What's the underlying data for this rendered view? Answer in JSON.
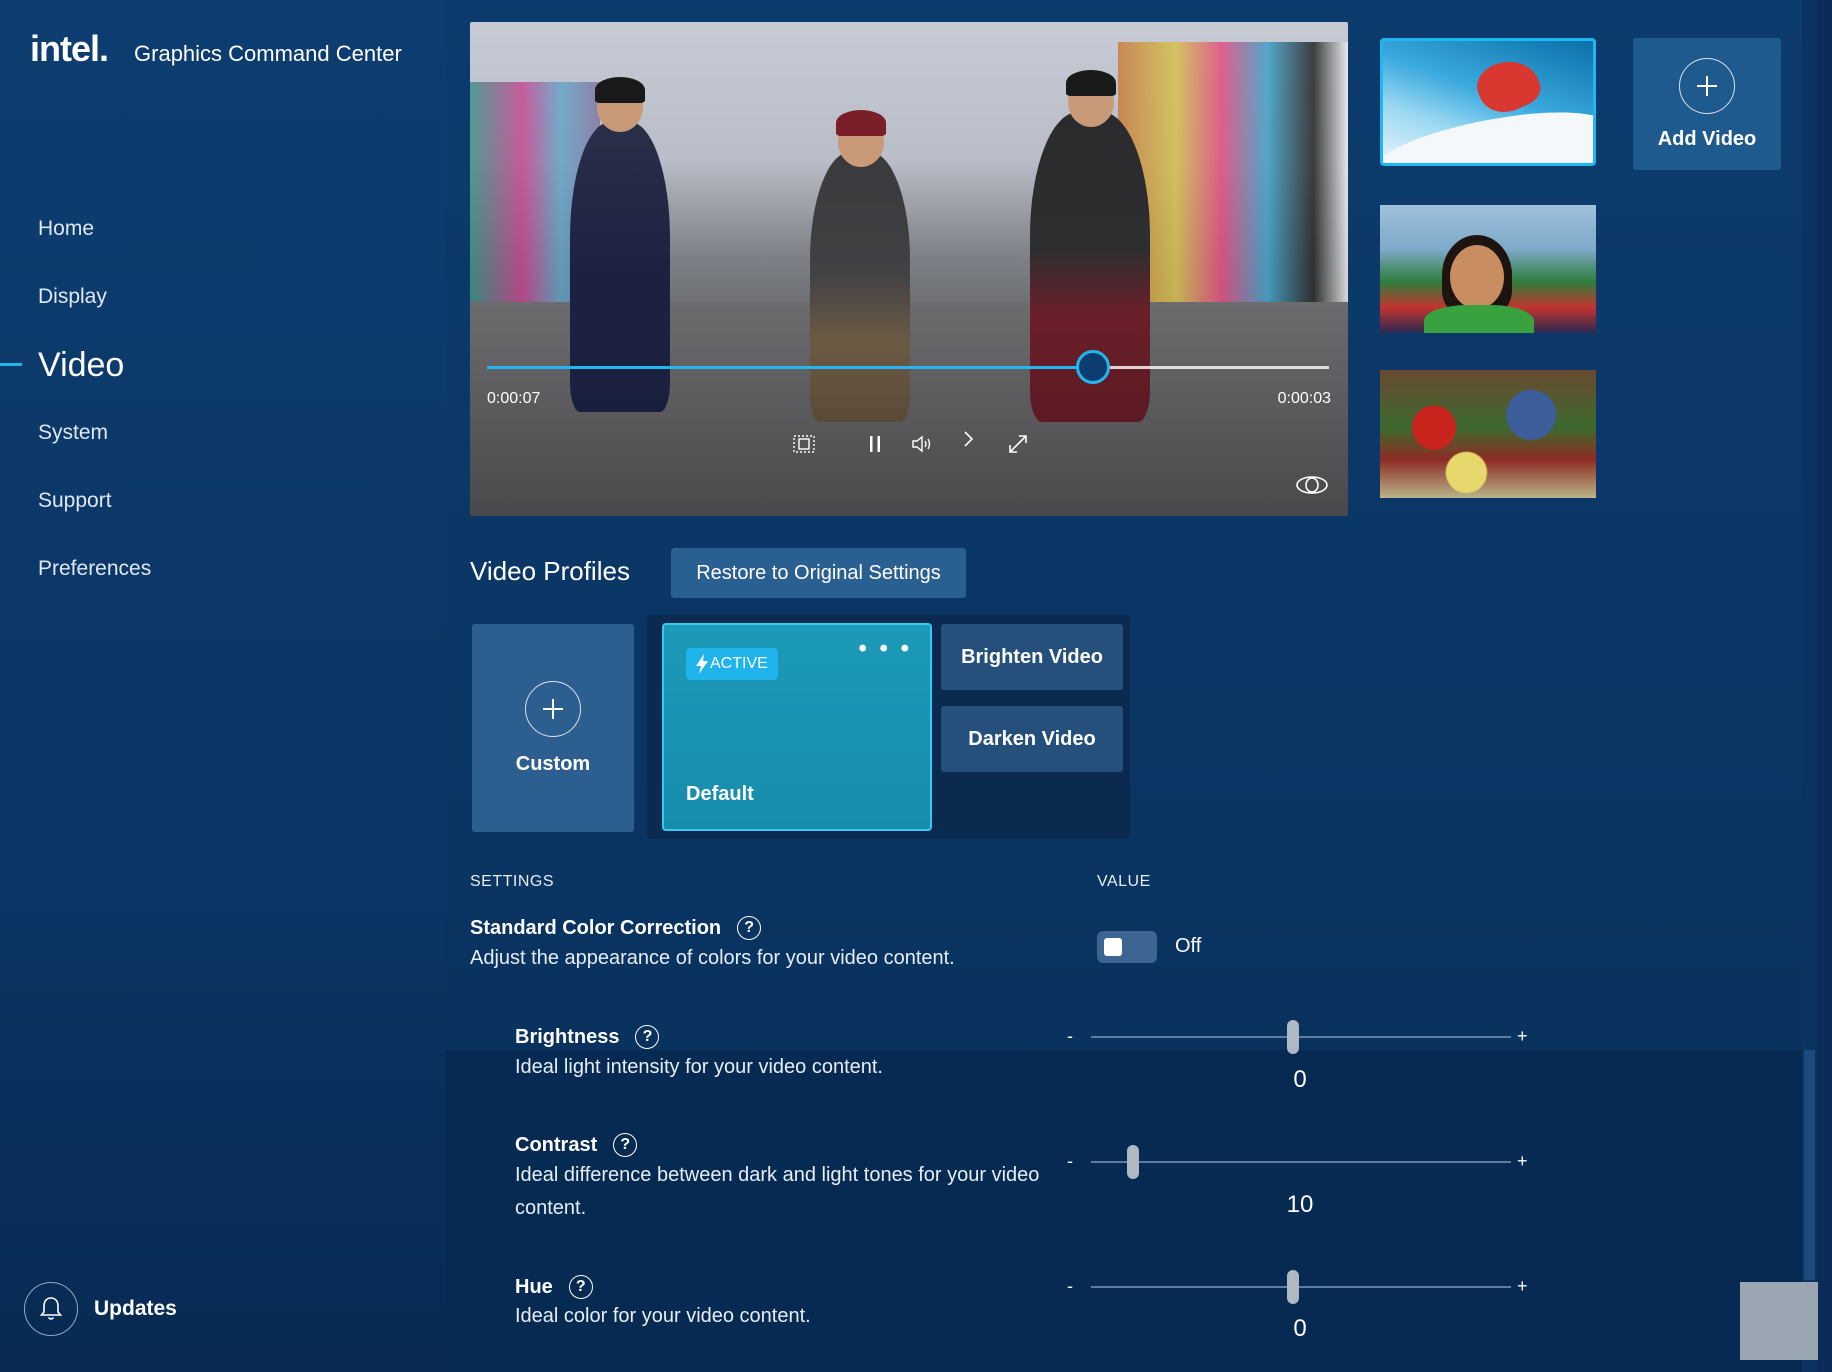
{
  "app": {
    "logo": "intel.",
    "title": "Graphics Command Center"
  },
  "nav": {
    "items": [
      {
        "label": "Home"
      },
      {
        "label": "Display"
      },
      {
        "label": "Video"
      },
      {
        "label": "System"
      },
      {
        "label": "Support"
      },
      {
        "label": "Preferences"
      }
    ],
    "active": "Video"
  },
  "updates": {
    "label": "Updates",
    "icon": "bell-icon"
  },
  "player": {
    "elapsed": "0:00:07",
    "remaining": "0:00:03",
    "progress_fraction": 0.72,
    "controls": [
      "aspect-icon",
      "pause-icon",
      "volume-icon",
      "next-icon",
      "fullscreen-icon"
    ],
    "compare_icon": "eye-icon"
  },
  "thumbnails": [
    {
      "name": "snowboarder",
      "selected": true
    },
    {
      "name": "crowd-smiling"
    },
    {
      "name": "market-produce"
    }
  ],
  "add_video": {
    "label": "Add Video"
  },
  "profiles": {
    "title": "Video Profiles",
    "restore_label": "Restore to Original Settings",
    "custom_label": "Custom",
    "active_badge": "ACTIVE",
    "active_profile": "Default",
    "more_menu": "• • •",
    "presets": [
      "Brighten Video",
      "Darken Video"
    ]
  },
  "settings": {
    "header": "SETTINGS",
    "value_header": "VALUE",
    "color_correction": {
      "title": "Standard Color Correction",
      "help": "?",
      "description": "Adjust the appearance of colors for your video content.",
      "state": "Off"
    },
    "brightness": {
      "title": "Brightness",
      "help": "?",
      "description": "Ideal light intensity for your video content.",
      "min_label": "-",
      "max_label": "+",
      "value": "0",
      "fraction": 0.48
    },
    "contrast": {
      "title": "Contrast",
      "help": "?",
      "description": "Ideal difference between dark and light tones for your video content.",
      "min_label": "-",
      "max_label": "+",
      "value": "10",
      "fraction": 0.1
    },
    "hue": {
      "title": "Hue",
      "help": "?",
      "description": "Ideal color for your video content.",
      "min_label": "-",
      "max_label": "+",
      "value": "0",
      "fraction": 0.48
    }
  },
  "colors": {
    "accent": "#21b6ef",
    "background": "#0a3564",
    "active_card": "#188cad"
  }
}
